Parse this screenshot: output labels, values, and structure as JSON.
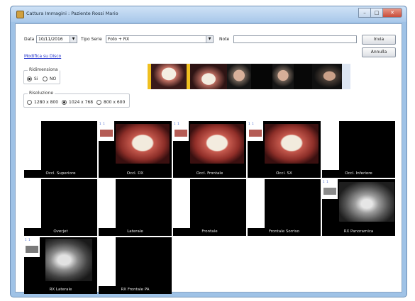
{
  "window": {
    "title": "Cattura Immagini : Paziente Rossi Mario"
  },
  "form": {
    "data_label": "Data",
    "data_value": "10/11/2016",
    "tipo_serie_label": "Tipo Serie",
    "tipo_serie_value": "Foto + RX",
    "note_label": "Note",
    "note_value": ""
  },
  "buttons": {
    "invia": "Invia",
    "annulla": "Annulla"
  },
  "link_disco": "Modifica su Disco",
  "ridimensiona": {
    "title": "Ridimensiona",
    "options": [
      "Si",
      "NO"
    ],
    "selected": "Si"
  },
  "risoluzione": {
    "title": "Risoluzione",
    "options": [
      "1280 x 800",
      "1024 x 768",
      "800 x 600"
    ],
    "selected": "1024 x 768"
  },
  "cells": [
    {
      "label": "Occl. Superiore",
      "kind": "empty"
    },
    {
      "label": "Occl. DX",
      "kind": "smile"
    },
    {
      "label": "Occl. Frontale",
      "kind": "smile"
    },
    {
      "label": "Occl. SX",
      "kind": "smile"
    },
    {
      "label": "Occl. Inferiore",
      "kind": "empty"
    },
    {
      "label": "Overjet",
      "kind": "empty"
    },
    {
      "label": "Laterale",
      "kind": "empty"
    },
    {
      "label": "Frontale",
      "kind": "empty"
    },
    {
      "label": "Frontale Sorriso",
      "kind": "empty"
    },
    {
      "label": "RX Panoramica",
      "kind": "xray"
    },
    {
      "label": "RX Laterale",
      "kind": "ceph"
    },
    {
      "label": "RX Frontale PA",
      "kind": "empty"
    }
  ]
}
